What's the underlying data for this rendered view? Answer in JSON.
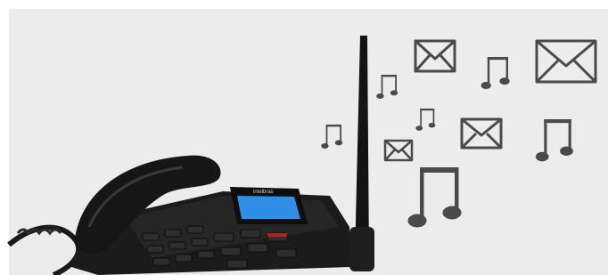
{
  "scene": {
    "description_icons": {
      "notes": [
        "music-note-icon",
        "music-note-icon",
        "music-note-icon",
        "music-note-icon",
        "music-note-icon",
        "music-note-icon"
      ],
      "envelopes": [
        "envelope-icon",
        "envelope-icon",
        "envelope-icon",
        "envelope-icon"
      ]
    },
    "phone": {
      "brand_logo": "intelbras",
      "screen_color": "#2f8ee6"
    },
    "colors": {
      "background": "#ececec",
      "icon_gray": "#4a4a4a",
      "phone_body": "#1a1a1a"
    }
  }
}
